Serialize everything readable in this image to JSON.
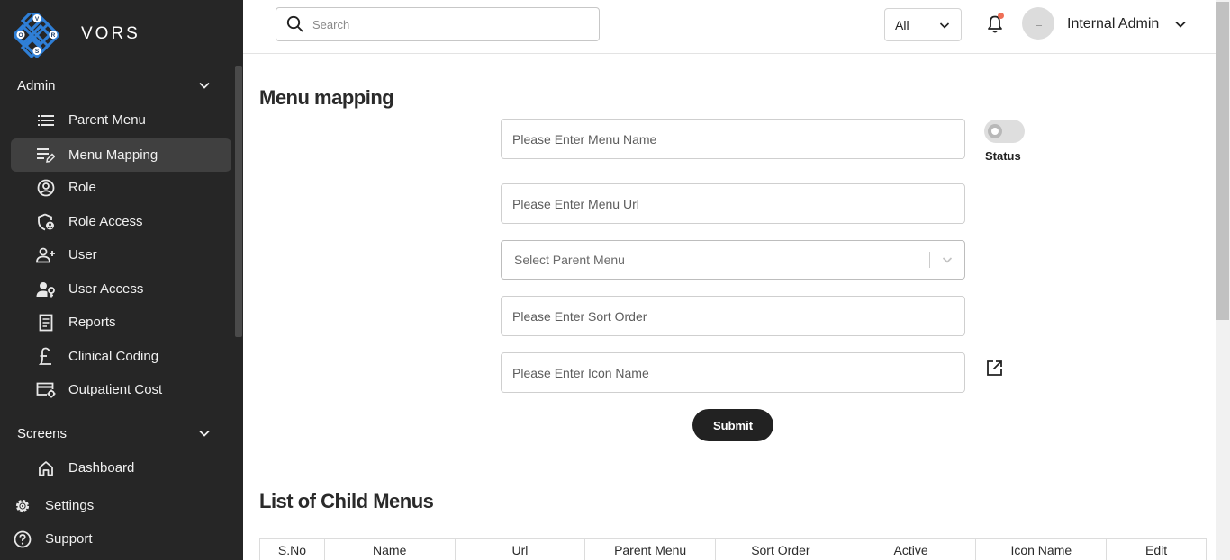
{
  "brand": {
    "name": "VORS",
    "logo_letters": [
      "V",
      "O",
      "R",
      "S"
    ],
    "logo_color": "#2f7fd6"
  },
  "sidebar": {
    "sections": [
      {
        "label": "Admin",
        "items": [
          {
            "label": "Parent Menu",
            "icon": "list-icon"
          },
          {
            "label": "Menu Mapping",
            "icon": "edit-list-icon",
            "active": true
          },
          {
            "label": "Role",
            "icon": "user-circle-icon"
          },
          {
            "label": "Role Access",
            "icon": "shield-user-icon"
          },
          {
            "label": "User",
            "icon": "user-plus-icon"
          },
          {
            "label": "User Access",
            "icon": "user-key-icon"
          },
          {
            "label": "Reports",
            "icon": "report-icon"
          },
          {
            "label": "Clinical Coding",
            "icon": "pound-icon"
          },
          {
            "label": "Outpatient Cost",
            "icon": "card-settings-icon"
          }
        ]
      },
      {
        "label": "Screens",
        "items": [
          {
            "label": "Dashboard",
            "icon": "home-icon"
          }
        ]
      }
    ],
    "footer": [
      {
        "label": "Settings",
        "icon": "gear-icon"
      },
      {
        "label": "Support",
        "icon": "help-icon"
      }
    ]
  },
  "header": {
    "search_placeholder": "Search",
    "filter_value": "All",
    "user_name": "Internal Admin",
    "notification_dot_color": "#ef6f57"
  },
  "form": {
    "title": "Menu mapping",
    "menu_name_placeholder": "Please Enter Menu Name",
    "menu_url_placeholder": "Please Enter Menu Url",
    "parent_menu_placeholder": "Select Parent Menu",
    "sort_order_placeholder": "Please Enter Sort Order",
    "icon_name_placeholder": "Please Enter Icon Name",
    "status_label": "Status",
    "status_on": false,
    "submit_label": "Submit"
  },
  "list": {
    "title": "List of Child Menus",
    "columns": [
      "S.No",
      "Name",
      "Url",
      "Parent Menu",
      "Sort Order",
      "Active",
      "Icon Name",
      "Edit"
    ],
    "rows": []
  }
}
